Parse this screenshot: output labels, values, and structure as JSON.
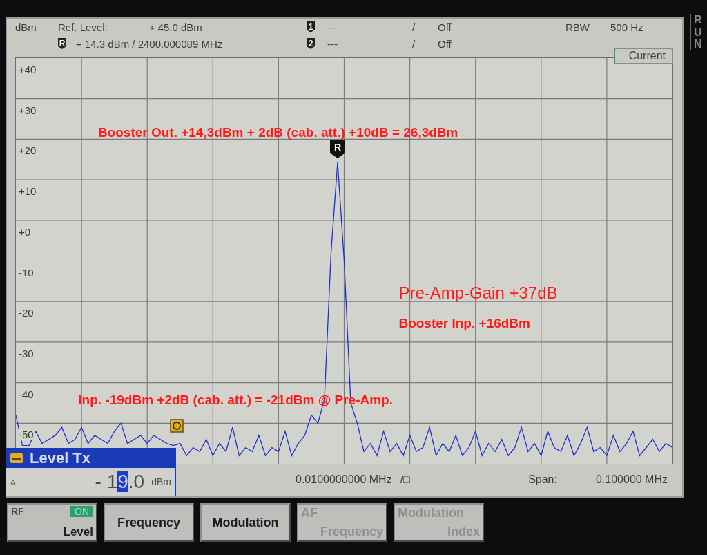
{
  "header": {
    "unit": "dBm",
    "ref_label": "Ref. Level:",
    "ref_value": "+ 45.0 dBm",
    "ref_marker": {
      "symbol": "R",
      "reading": "+ 14.3 dBm / 2400.000089 MHz"
    },
    "markers": [
      {
        "symbol": "1",
        "value": "---",
        "separator": "/",
        "state": "Off"
      },
      {
        "symbol": "2",
        "value": "---",
        "separator": "/",
        "state": "Off"
      }
    ],
    "rbw_label": "RBW",
    "rbw_value": "500 Hz"
  },
  "plot": {
    "peak_marker": "R",
    "chart_data": {
      "type": "line",
      "grid": true,
      "ylim": [
        -60,
        40
      ],
      "yticks": [
        {
          "value": 40,
          "label": "+40"
        },
        {
          "value": 30,
          "label": "+30"
        },
        {
          "value": 20,
          "label": "+20"
        },
        {
          "value": 10,
          "label": "+10"
        },
        {
          "value": 0,
          "label": "+0"
        },
        {
          "value": -10,
          "label": "-10"
        },
        {
          "value": -20,
          "label": "-20"
        },
        {
          "value": -30,
          "label": "-30"
        },
        {
          "value": -40,
          "label": "-40"
        },
        {
          "value": -50,
          "label": "-50"
        }
      ],
      "series": [
        {
          "name": "Current",
          "color": "#1c2ed0",
          "values": [
            -48,
            -55.5,
            -55.5,
            -52,
            -55,
            -54,
            -53,
            -51,
            -55,
            -54,
            -51,
            -55,
            -53,
            -54,
            -55,
            -52,
            -50,
            -55,
            -54,
            -53,
            -55,
            -53,
            -54,
            -55,
            -55.5,
            -55,
            -58,
            -56,
            -57,
            -54,
            -58,
            -55,
            -57,
            -51,
            -58,
            -56,
            -57,
            -53,
            -58,
            -56,
            -57,
            -52,
            -58,
            -55,
            -53,
            -48,
            -50,
            -44,
            -8,
            14.3,
            -10,
            -45,
            -50,
            -57,
            -55,
            -58,
            -52,
            -57,
            -55,
            -58,
            -53,
            -57,
            -56,
            -51,
            -58,
            -55,
            -57,
            -53,
            -58,
            -56,
            -52,
            -58,
            -55,
            -57,
            -54,
            -58,
            -56,
            -51,
            -57,
            -55,
            -58,
            -52,
            -56,
            -57,
            -53,
            -58,
            -55,
            -51,
            -57,
            -56,
            -58,
            -53,
            -57,
            -55,
            -52,
            -58,
            -56,
            -54,
            -57,
            -55,
            -56
          ]
        }
      ]
    },
    "annotations": [
      {
        "text": "Booster Out. +14,3dBm + 2dB (cab. att.) +10dB = 26,3dBm",
        "kind": "bold"
      },
      {
        "text": "Pre-Amp-Gain +37dB",
        "kind": "plain"
      },
      {
        "text": "Booster Inp. +16dBm",
        "kind": "bold"
      },
      {
        "text": "Inp. -19dBm +2dB (cab. att.) = -21dBm @ Pre-Amp.",
        "kind": "bold"
      }
    ],
    "center_frequency": "0.0100000000 MHz",
    "center_suffix": "/□",
    "span_label": "Span:",
    "span_value": "0.100000 MHz"
  },
  "level_dialog": {
    "title": "Level Tx",
    "value_before": "- 1",
    "value_cursor": "9",
    "value_after": ".0",
    "unit": "dBm"
  },
  "buttons": [
    {
      "kind": "rf",
      "lines": [
        "RF",
        "Level"
      ],
      "badge": "ON",
      "disabled": false
    },
    {
      "kind": "plain",
      "lines": [
        "Frequency"
      ],
      "disabled": false
    },
    {
      "kind": "plain",
      "lines": [
        "Modulation"
      ],
      "disabled": false
    },
    {
      "kind": "plain",
      "lines": [
        "AF",
        "Frequency"
      ],
      "disabled": true
    },
    {
      "kind": "plain",
      "lines": [
        "Modulation",
        "Index"
      ],
      "disabled": true
    }
  ],
  "run_indicator": "RUN"
}
